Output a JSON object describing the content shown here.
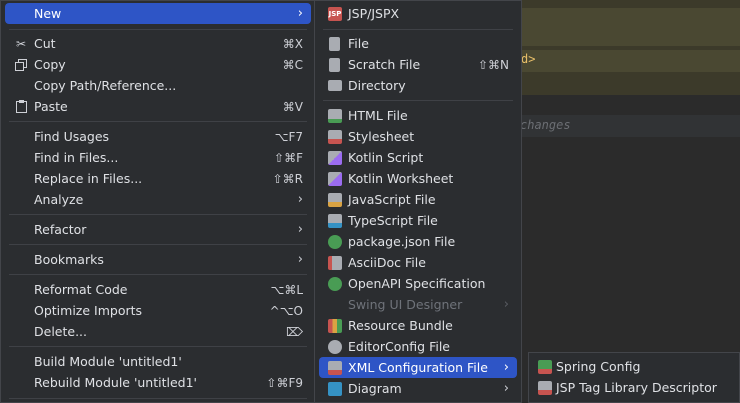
{
  "editor": {
    "code_fragment": "d>",
    "hint_text": "changes"
  },
  "context_menu": {
    "items": [
      {
        "label": "New",
        "submenu": true,
        "selected": true
      },
      {
        "label": "Cut",
        "shortcut": "⌘X",
        "icon": "scissors-icon"
      },
      {
        "label": "Copy",
        "shortcut": "⌘C",
        "icon": "copy-icon"
      },
      {
        "label": "Copy Path/Reference..."
      },
      {
        "label": "Paste",
        "shortcut": "⌘V",
        "icon": "clipboard-icon"
      },
      {
        "label": "Find Usages",
        "shortcut": "⌥F7"
      },
      {
        "label": "Find in Files...",
        "shortcut": "⇧⌘F"
      },
      {
        "label": "Replace in Files...",
        "shortcut": "⇧⌘R"
      },
      {
        "label": "Analyze",
        "submenu": true
      },
      {
        "label": "Refactor",
        "submenu": true
      },
      {
        "label": "Bookmarks",
        "submenu": true
      },
      {
        "label": "Reformat Code",
        "shortcut": "⌥⌘L"
      },
      {
        "label": "Optimize Imports",
        "shortcut": "^⌥O"
      },
      {
        "label": "Delete...",
        "shortcut": "⌦"
      },
      {
        "label": "Build Module 'untitled1'"
      },
      {
        "label": "Rebuild Module 'untitled1'",
        "shortcut": "⇧⌘F9"
      }
    ]
  },
  "new_submenu": {
    "items": [
      {
        "label": "JSP/JSPX",
        "icon": "jsp-icon"
      },
      {
        "label": "File",
        "icon": "file-icon"
      },
      {
        "label": "Scratch File",
        "shortcut": "⇧⌘N",
        "icon": "scratch-file-icon"
      },
      {
        "label": "Directory",
        "icon": "folder-icon"
      },
      {
        "label": "HTML File",
        "icon": "html-icon"
      },
      {
        "label": "Stylesheet",
        "icon": "css-icon"
      },
      {
        "label": "Kotlin Script",
        "icon": "kotlin-icon"
      },
      {
        "label": "Kotlin Worksheet",
        "icon": "kotlin-worksheet-icon"
      },
      {
        "label": "JavaScript File",
        "icon": "javascript-icon"
      },
      {
        "label": "TypeScript File",
        "icon": "typescript-icon"
      },
      {
        "label": "package.json File",
        "icon": "nodejs-icon"
      },
      {
        "label": "AsciiDoc File",
        "icon": "asciidoc-icon"
      },
      {
        "label": "OpenAPI Specification",
        "icon": "openapi-icon"
      },
      {
        "label": "Swing UI Designer",
        "disabled": true,
        "submenu": true
      },
      {
        "label": "Resource Bundle",
        "icon": "resource-bundle-icon"
      },
      {
        "label": "EditorConfig File",
        "icon": "editorconfig-icon"
      },
      {
        "label": "XML Configuration File",
        "submenu": true,
        "selected": true,
        "icon": "xml-icon"
      },
      {
        "label": "Diagram",
        "submenu": true,
        "icon": "diagram-icon"
      }
    ]
  },
  "xml_submenu": {
    "items": [
      {
        "label": "Spring Config",
        "icon": "spring-xml-icon"
      },
      {
        "label": "JSP Tag Library Descriptor",
        "icon": "tld-icon"
      }
    ]
  },
  "colors": {
    "menu_bg": "#2b2d30",
    "selection": "#2e55c6",
    "text": "#dfe1e5",
    "disabled_text": "#6f737a"
  }
}
